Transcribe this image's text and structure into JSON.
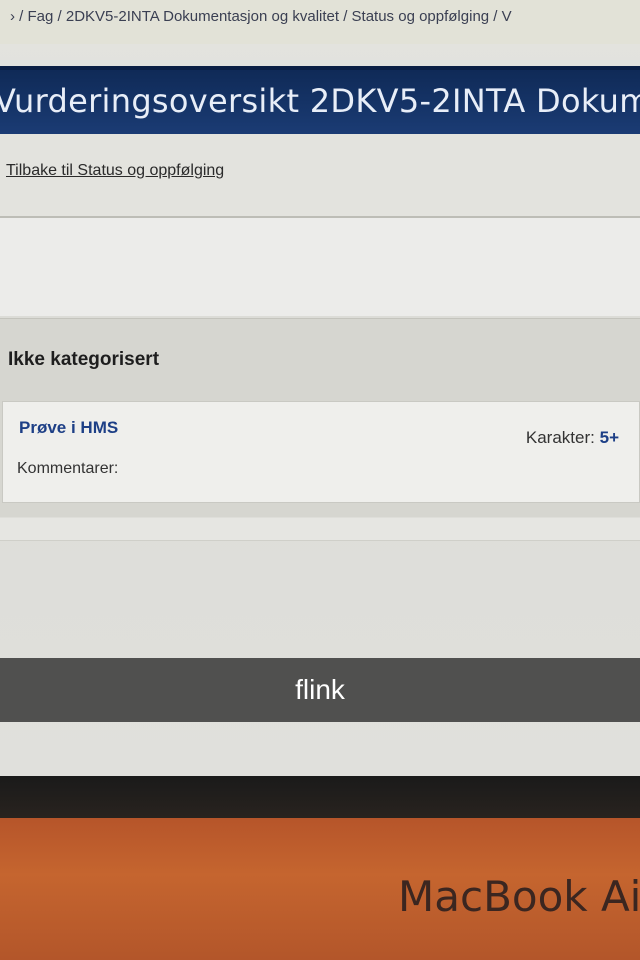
{
  "breadcrumb": {
    "text": "› / Fag / 2DKV5-2INTA Dokumentasjon og kvalitet / Status og oppfølging / V"
  },
  "page": {
    "title": "Vurderingsoversikt 2DKV5-2INTA Dokum",
    "back_link": "Tilbake til Status og oppfølging"
  },
  "category": {
    "title": "Ikke kategorisert",
    "item": {
      "name": "Prøve i HMS",
      "grade_label": "Karakter:",
      "grade_value": "5+",
      "comments_label": "Kommentarer:"
    }
  },
  "caption": {
    "text": "flink"
  },
  "laptop": {
    "brand": "MacBook Ai"
  },
  "colors": {
    "title_bar": "#0f2a57",
    "link": "#1d3f86",
    "chassis": "#c5652f"
  }
}
